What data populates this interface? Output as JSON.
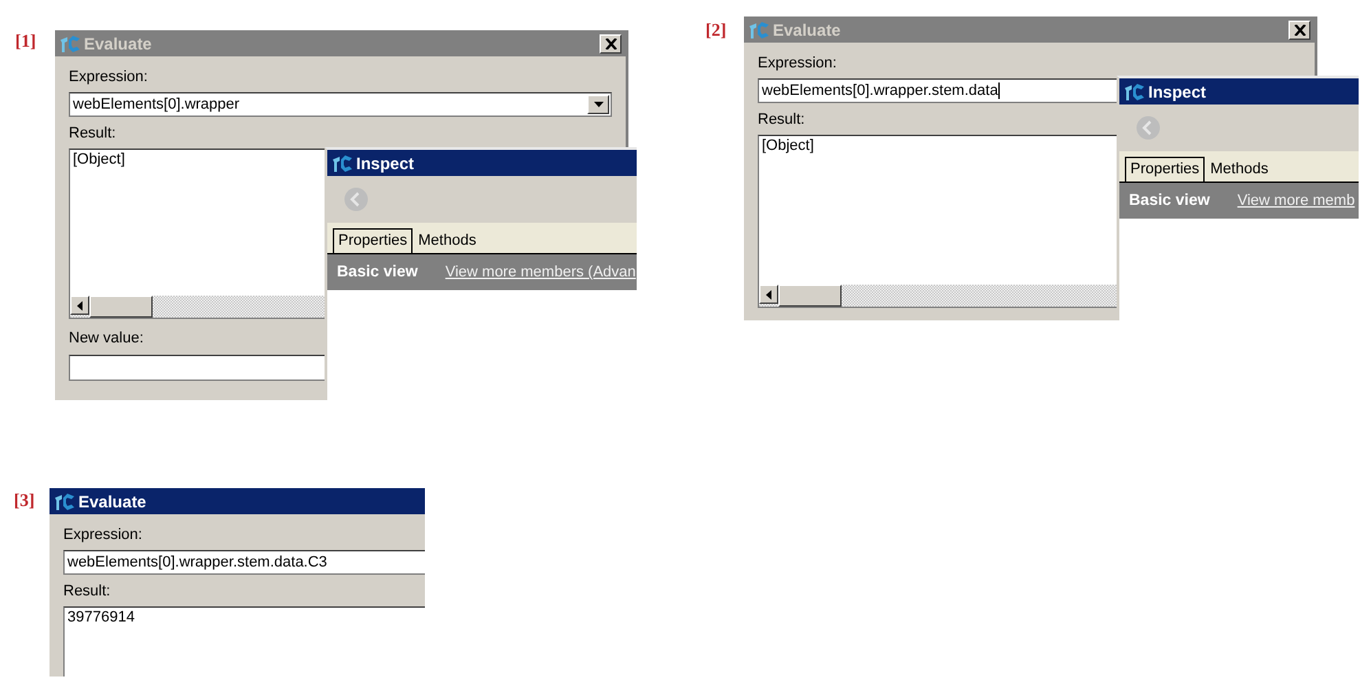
{
  "panels": [
    {
      "label": "[1]",
      "evaluate": {
        "title": "Evaluate",
        "active": false,
        "close": true,
        "expression_label": "Expression:",
        "expression": "webElements[0].wrapper",
        "dropdown": true,
        "result_label": "Result:",
        "result": "[Object]",
        "scrollbar": true,
        "new_value_label": "New value:"
      },
      "inspect": {
        "title": "Inspect",
        "active": true,
        "tabs": [
          {
            "label": "Properties",
            "selected": true
          },
          {
            "label": "Methods",
            "selected": false
          }
        ],
        "view_label": "Basic view",
        "link": "View more members (Advan"
      }
    },
    {
      "label": "[2]",
      "evaluate": {
        "title": "Evaluate",
        "active": false,
        "close": true,
        "expression_label": "Expression:",
        "expression": "webElements[0].wrapper.stem.data",
        "caret": true,
        "result_label": "Result:",
        "result": "[Object]",
        "scrollbar": true
      },
      "inspect": {
        "title": "Inspect",
        "active": true,
        "tabs": [
          {
            "label": "Properties",
            "selected": true
          },
          {
            "label": "Methods",
            "selected": false
          }
        ],
        "view_label": "Basic view",
        "link": "View more memb"
      }
    },
    {
      "label": "[3]",
      "evaluate": {
        "title": "Evaluate",
        "active": true,
        "expression_label": "Expression:",
        "expression": "webElements[0].wrapper.stem.data.C3",
        "result_label": "Result:",
        "result": "39776914"
      }
    }
  ]
}
